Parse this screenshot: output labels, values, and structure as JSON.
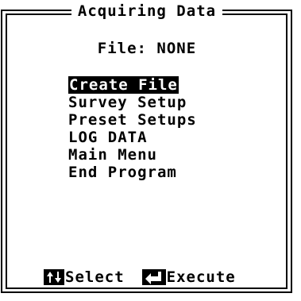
{
  "title": "Acquiring Data",
  "file_line": "File: NONE",
  "menu": {
    "items": [
      {
        "label": "Create File",
        "selected": true
      },
      {
        "label": "Survey Setup",
        "selected": false
      },
      {
        "label": "Preset Setups",
        "selected": false
      },
      {
        "label": "LOG DATA",
        "selected": false
      },
      {
        "label": "Main Menu",
        "selected": false
      },
      {
        "label": "End Program",
        "selected": false
      }
    ]
  },
  "footer": {
    "select_icon": "up-down-arrows-icon",
    "select_label": "Select",
    "execute_icon": "enter-key-icon",
    "execute_label": "Execute"
  }
}
